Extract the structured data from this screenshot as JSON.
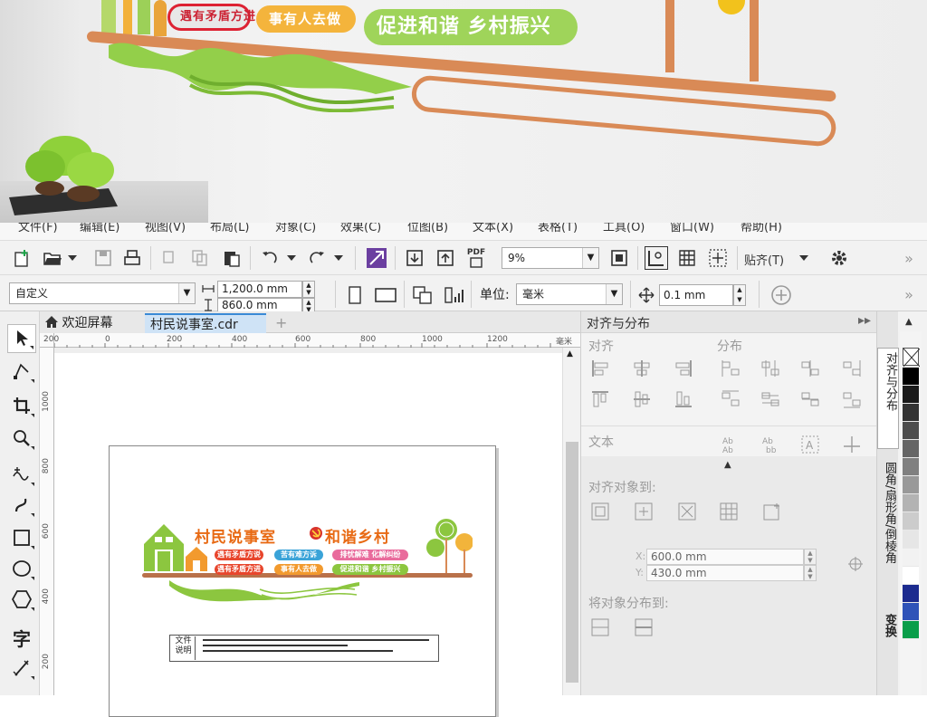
{
  "banner": {
    "sign_1": "遇有矛盾方进",
    "sign_2": "事有人去做",
    "sign_3": "促进和谐 乡村振兴"
  },
  "menubar": [
    "文件(F)",
    "编辑(E)",
    "视图(V)",
    "布局(L)",
    "对象(C)",
    "效果(C)",
    "位图(B)",
    "文本(X)",
    "表格(T)",
    "工具(O)",
    "窗口(W)",
    "帮助(H)"
  ],
  "toolbar": {
    "pdf_label": "PDF",
    "zoom_value": "9%",
    "snap_label": "贴齐(T)",
    "overflow": "»"
  },
  "propertybar": {
    "page_preset": "自定义",
    "width": "1,200.0 mm",
    "height": "860.0 mm",
    "units_label": "单位:",
    "units_value": "毫米",
    "nudge_value": "0.1 mm",
    "overflow": "»"
  },
  "tabs": {
    "welcome": "欢迎屏幕",
    "document": "村民说事室.cdr",
    "add": "+"
  },
  "rulers": {
    "h_ticks": [
      "200",
      "0",
      "200",
      "400",
      "600",
      "800",
      "1000",
      "1200"
    ],
    "h_unit": "毫米",
    "v_ticks": [
      "1000",
      "800",
      "600",
      "400",
      "200"
    ]
  },
  "artwork": {
    "title_left": "村民说事室",
    "title_right": "和谐乡村",
    "pills": [
      {
        "text": "遇有矛盾方说",
        "color": "#e8452c"
      },
      {
        "text": "苦有难方诉",
        "color": "#3aa3d8"
      },
      {
        "text": "排忧解难 化解纠纷",
        "color": "#e96b9c"
      },
      {
        "text": "遇有矛盾方进",
        "color": "#e8452c"
      },
      {
        "text": "事有人去做",
        "color": "#f29a2e"
      },
      {
        "text": "促进和谐 乡村振兴",
        "color": "#8cc63f"
      }
    ],
    "note_label": "文件\n说明"
  },
  "docker": {
    "title": "对齐与分布",
    "align_label": "对齐",
    "distribute_label": "分布",
    "text_label": "文本",
    "align_to_label": "对齐对象到:",
    "x_label": "X:",
    "x_value": "600.0 mm",
    "y_label": "Y:",
    "y_value": "430.0 mm",
    "distribute_to_label": "将对象分布到:"
  },
  "vertical_tabs": [
    "对齐与分布",
    "圆角/扇形角/倒棱角",
    "变换"
  ],
  "palette": [
    "#ffffff",
    "#000000",
    "#1a1a1a",
    "#333333",
    "#4d4d4d",
    "#666666",
    "#808080",
    "#999999",
    "#b3b3b3",
    "#cccccc",
    "#e6e6e6",
    "#f2f2f2",
    "#ffffff",
    "#1c2b8f",
    "#2f53b8",
    "#0a9e4a"
  ],
  "colors": {
    "accent_orange": "#e86a14",
    "accent_green": "#8cc63f",
    "shelf_copper": "#d98a56"
  }
}
